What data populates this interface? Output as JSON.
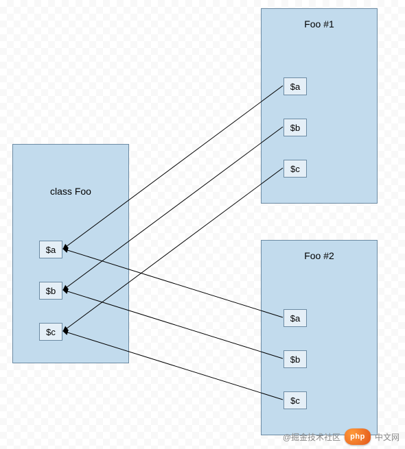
{
  "left_box": {
    "title": "class Foo",
    "vars": [
      "$a",
      "$b",
      "$c"
    ]
  },
  "instance1": {
    "title": "Foo  #1",
    "vars": [
      "$a",
      "$b",
      "$c"
    ]
  },
  "instance2": {
    "title": "Foo  #2",
    "vars": [
      "$a",
      "$b",
      "$c"
    ]
  },
  "watermark": {
    "site": "中文网",
    "badge": "php",
    "community": "@掘金技术社区"
  },
  "diagram": {
    "description": "Class diagram showing class Foo with properties $a, $b, $c and two instances Foo #1 and Foo #2, each with slots $a, $b, $c pointing back to the class definition properties.",
    "arrows": [
      {
        "from": "Foo#1.$a",
        "to": "classFoo.$a"
      },
      {
        "from": "Foo#1.$b",
        "to": "classFoo.$b"
      },
      {
        "from": "Foo#1.$c",
        "to": "classFoo.$c"
      },
      {
        "from": "Foo#2.$a",
        "to": "classFoo.$a"
      },
      {
        "from": "Foo#2.$b",
        "to": "classFoo.$b"
      },
      {
        "from": "Foo#2.$c",
        "to": "classFoo.$c"
      }
    ]
  }
}
